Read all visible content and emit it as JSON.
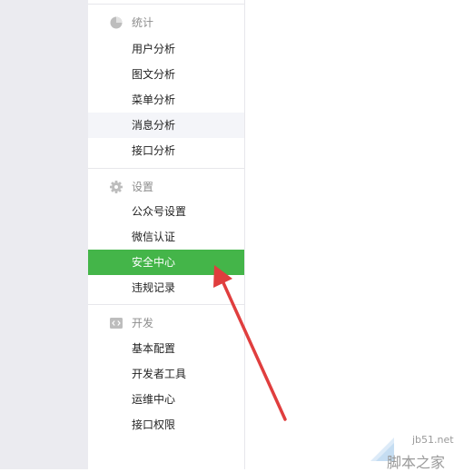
{
  "sections": [
    {
      "icon": "pie-chart-icon",
      "title": "统计",
      "items": [
        "用户分析",
        "图文分析",
        "菜单分析",
        "消息分析",
        "接口分析"
      ]
    },
    {
      "icon": "gear-icon",
      "title": "设置",
      "items": [
        "公众号设置",
        "微信认证",
        "安全中心",
        "违规记录"
      ]
    },
    {
      "icon": "code-icon",
      "title": "开发",
      "items": [
        "基本配置",
        "开发者工具",
        "运维中心",
        "接口权限"
      ]
    }
  ],
  "hovered_item": "消息分析",
  "active_item": "安全中心",
  "colors": {
    "active_bg": "#44b549",
    "hover_bg": "#f4f5f9",
    "arrow": "#e03e3e"
  },
  "watermark": {
    "url": "jb51.net",
    "name": "脚本之家"
  }
}
